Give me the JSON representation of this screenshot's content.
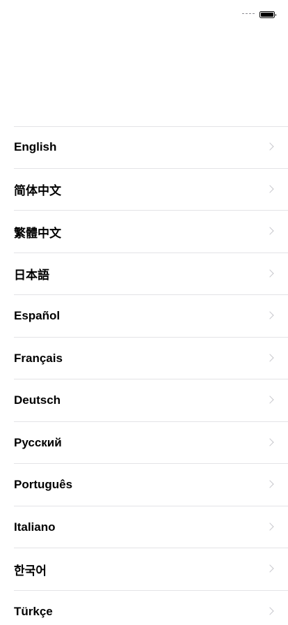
{
  "status_bar": {
    "signal_icon": "no-signal-dashes-icon",
    "battery_icon": "battery-full-icon",
    "battery_level": 1.0
  },
  "languages": [
    {
      "label": "English"
    },
    {
      "label": "简体中文"
    },
    {
      "label": "繁體中文"
    },
    {
      "label": "日本語"
    },
    {
      "label": "Español"
    },
    {
      "label": "Français"
    },
    {
      "label": "Deutsch"
    },
    {
      "label": "Русский"
    },
    {
      "label": "Português"
    },
    {
      "label": "Italiano"
    },
    {
      "label": "한국어"
    },
    {
      "label": "Türkçe"
    }
  ],
  "row_icon": "chevron-right-icon",
  "colors": {
    "background": "#ffffff",
    "text": "#000000",
    "separator": "#e3e3e6",
    "chevron": "#c7c7cc"
  }
}
